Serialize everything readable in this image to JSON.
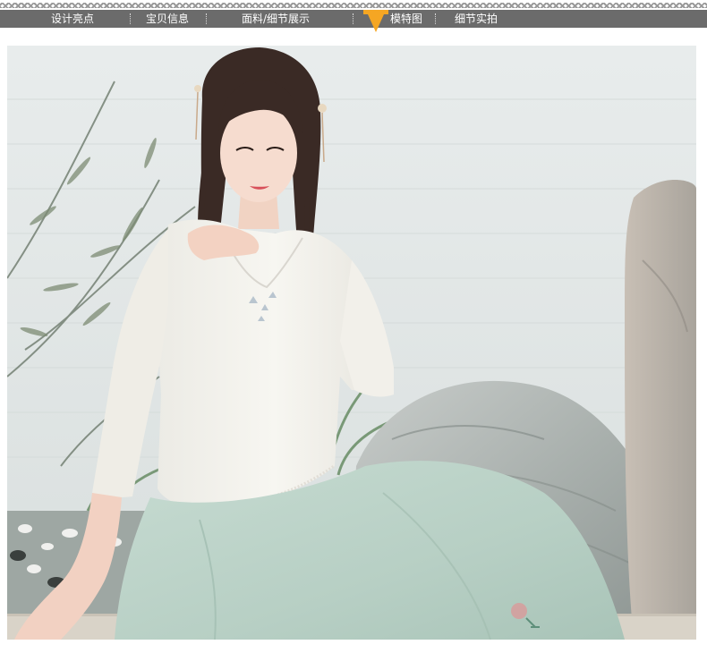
{
  "nav": {
    "items": [
      {
        "label": "设计亮点",
        "active": false
      },
      {
        "label": "宝贝信息",
        "active": false
      },
      {
        "label": "面料/细节展示",
        "active": false
      },
      {
        "label": "模特图",
        "active": true
      },
      {
        "label": "细节实拍",
        "active": false
      }
    ]
  },
  "colors": {
    "nav_background": "#6b6b6b",
    "nav_text": "#ffffff",
    "active_marker": "#f5a623",
    "blouse": "#f4f2ec",
    "skirt": "#bcd3c8",
    "wall": "#e2e6e6"
  },
  "icons": {
    "active_marker": "triangle-down-icon"
  }
}
